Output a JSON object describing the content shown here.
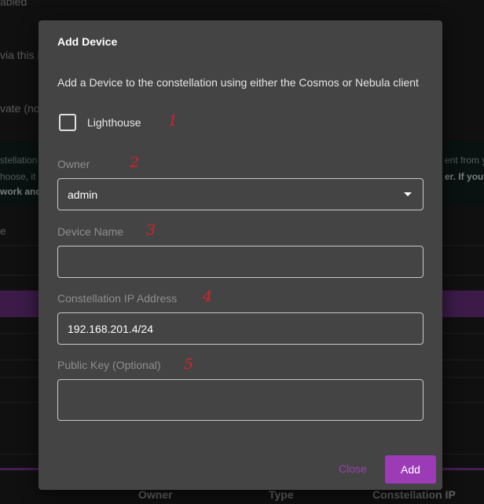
{
  "background": {
    "fragments": [
      "abled",
      "via this N",
      "vate (no"
    ],
    "banner": [
      "stellation l",
      "hoose, it",
      "work and"
    ],
    "banner_right": [
      "ent from yo",
      "er. If you c"
    ],
    "column_fragment": "e",
    "table_headers": [
      "Owner",
      "Type",
      "Constellation IP"
    ]
  },
  "dialog": {
    "title": "Add Device",
    "description": "Add a Device to the constellation using either the Cosmos or Nebula client",
    "lighthouse_label": "Lighthouse",
    "owner": {
      "label": "Owner",
      "value": "admin"
    },
    "device_name": {
      "label": "Device Name",
      "value": ""
    },
    "ip_address": {
      "label": "Constellation IP Address",
      "value": "192.168.201.4/24"
    },
    "public_key": {
      "label": "Public Key (Optional)",
      "value": ""
    },
    "close_label": "Close",
    "add_label": "Add"
  },
  "annotations": [
    "1",
    "2",
    "3",
    "4",
    "5"
  ],
  "colors": {
    "accent": "#9c3bb6",
    "annotation": "#d6222a",
    "dialog_bg": "#444444"
  }
}
